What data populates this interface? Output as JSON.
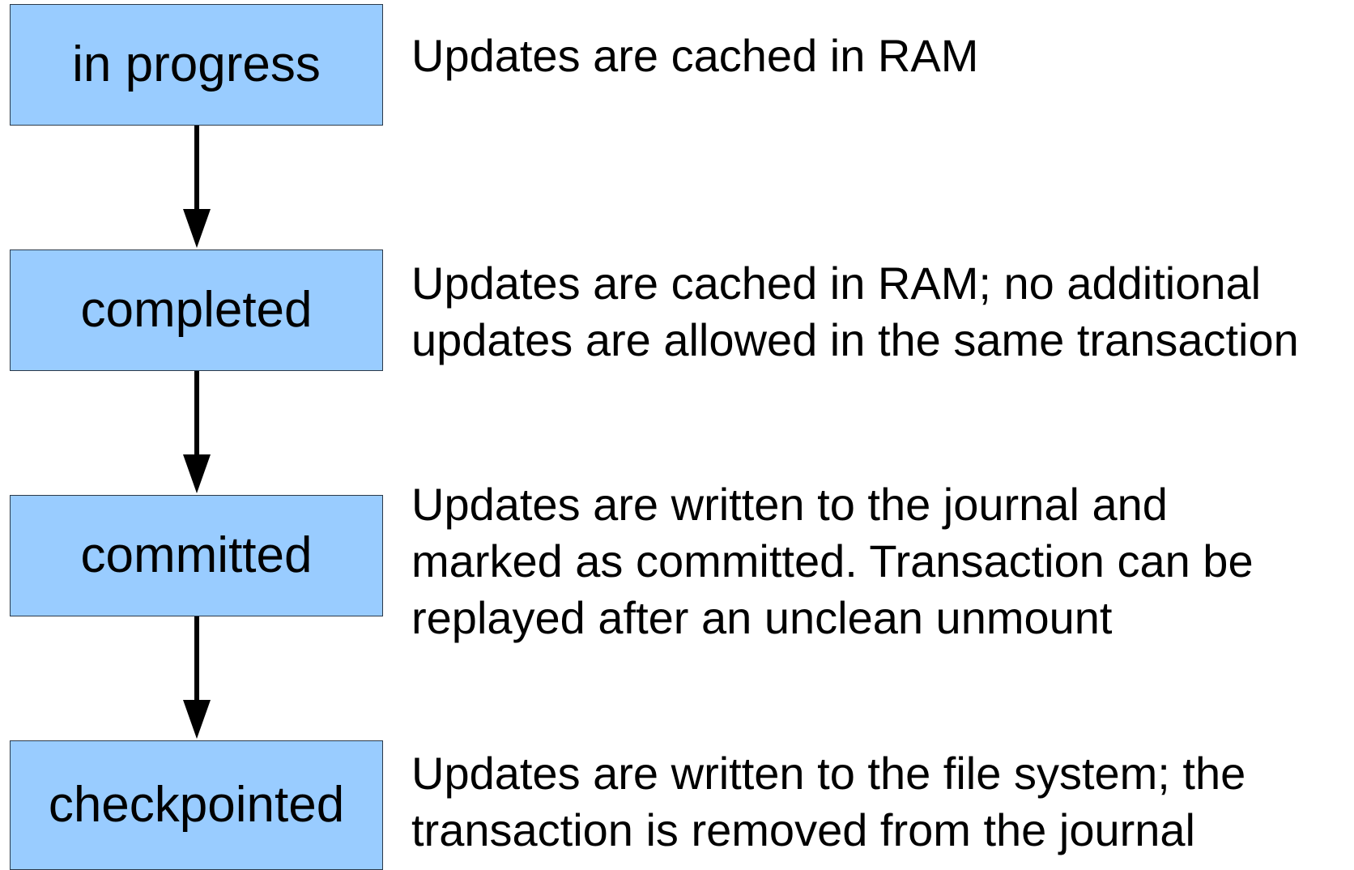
{
  "states": [
    {
      "label": "in progress",
      "description": [
        "Updates are cached in RAM"
      ]
    },
    {
      "label": "completed",
      "description": [
        "Updates are cached in RAM; no additional",
        "updates are allowed in the same transaction"
      ]
    },
    {
      "label": "committed",
      "description": [
        "Updates are written to the journal and",
        "marked as committed. Transaction can be",
        "replayed after an unclean unmount"
      ]
    },
    {
      "label": "checkpointed",
      "description": [
        "Updates are written to the file system; the",
        "transaction is removed from the journal"
      ]
    }
  ],
  "colors": {
    "box_fill": "#99ccff",
    "box_border": "#2b3a4a",
    "arrow": "#000000",
    "text": "#000000"
  }
}
